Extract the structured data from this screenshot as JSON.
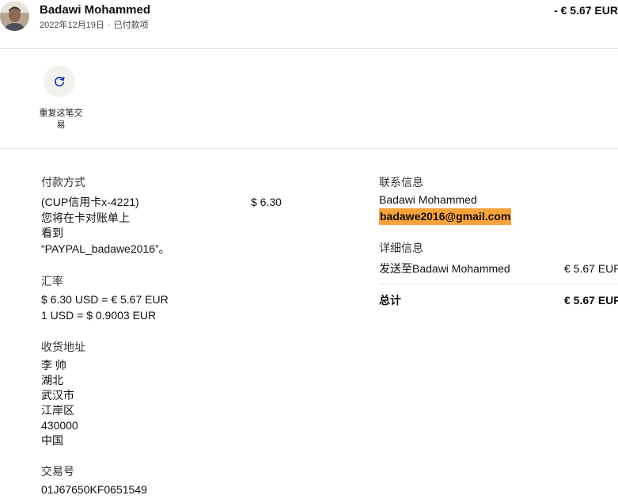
{
  "header": {
    "name": "Badawi Mohammed",
    "date": "2022年12月19日",
    "separator": "·",
    "status": "已付款项",
    "amount": "- € 5.67 EUR"
  },
  "actions": {
    "repeat_label": "重复这笔交易"
  },
  "payment": {
    "label": "付款方式",
    "line1": "(CUP信用卡x-4221)",
    "line2": "您将在卡对账单上",
    "line3": "看到",
    "line4": "“PAYPAL_badawe2016”。",
    "amount": "$ 6.30"
  },
  "exchange": {
    "label": "汇率",
    "line1": "$ 6.30 USD = € 5.67 EUR",
    "line2": "1 USD = $ 0.9003 EUR"
  },
  "shipping": {
    "label": "收货地址",
    "lines": [
      "李 帅",
      "湖北",
      "武汉市",
      "江岸区",
      "430000",
      "中国"
    ]
  },
  "transaction": {
    "label": "交易号",
    "id": "01J67650KF0651549"
  },
  "contact": {
    "label": "联系信息",
    "name": "Badawi Mohammed",
    "email": "badawe2016@gmail.com"
  },
  "details": {
    "label": "详细信息",
    "sent_to": "发送至Badawi Mohammed",
    "sent_amount": "€ 5.67 EUR",
    "total_label": "总计",
    "total_amount": "€ 5.67 EUR"
  },
  "colors": {
    "email_highlight": "#f7a23b",
    "divider": "#e6e6e6",
    "button_bg": "#f2f1ee",
    "icon": "#1a3fa8"
  }
}
